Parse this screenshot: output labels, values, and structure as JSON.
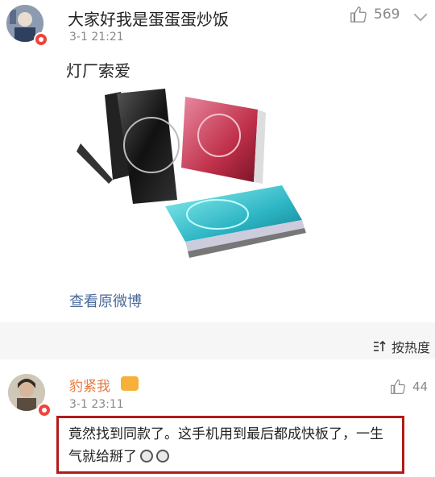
{
  "comments": [
    {
      "author": "大家好我是蛋蛋蛋炒饭",
      "time": "3-1 21:21",
      "likes": "569",
      "text": "灯厂索爱",
      "link": "查看原微博"
    },
    {
      "author": "豹紧我",
      "time": "3-1 23:11",
      "likes": "44",
      "text": "竟然找到同款了。这手机用到最后都成快板了，一生气就给掰了"
    }
  ],
  "sort": {
    "label": "按热度"
  },
  "colors": {
    "highlight_border": "#b21a1a",
    "link": "#4a6a9a",
    "author2": "#e8783a"
  },
  "icons": [
    "thumb-up-icon",
    "chevron-down-icon",
    "sort-icon",
    "verified-badge-icon"
  ]
}
